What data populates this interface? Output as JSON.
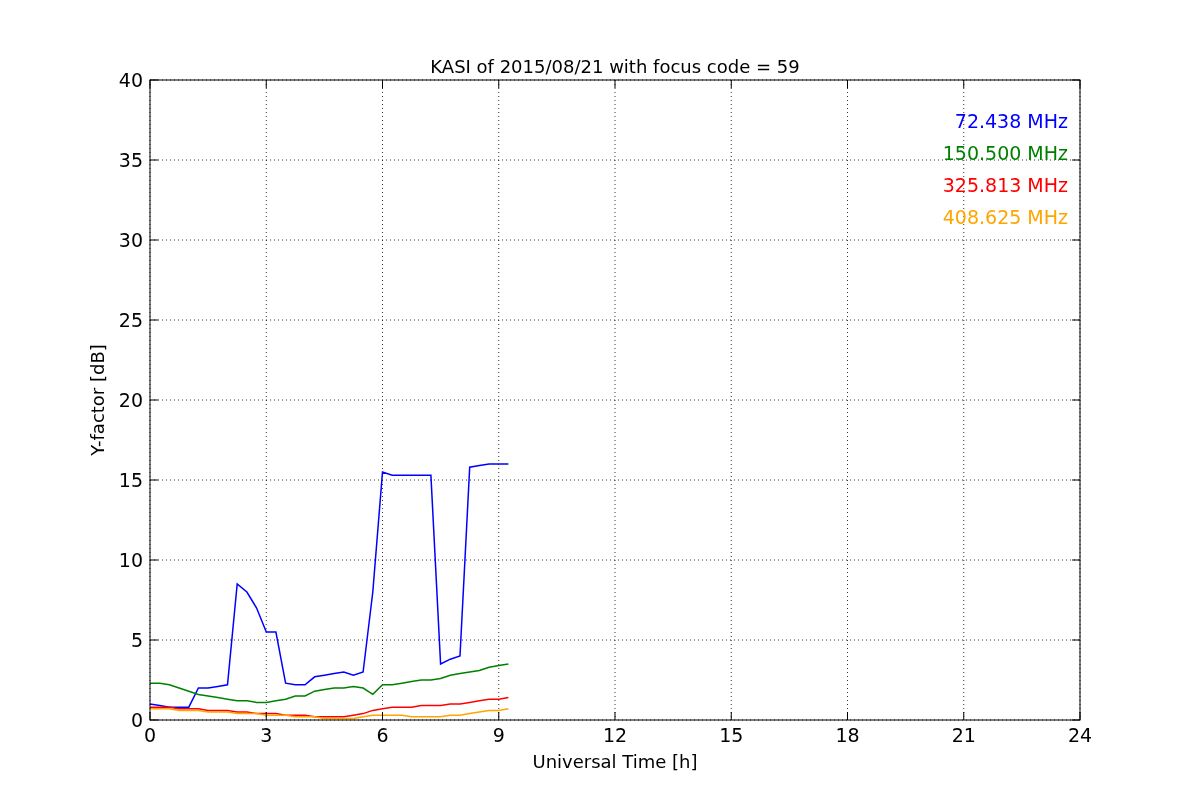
{
  "chart_data": {
    "type": "line",
    "title": "KASI of 2015/08/21 with focus code = 59",
    "xlabel": "Universal Time [h]",
    "ylabel": "Y-factor [dB]",
    "x": [
      0,
      0.25,
      0.5,
      0.75,
      1,
      1.25,
      1.5,
      1.75,
      2,
      2.25,
      2.5,
      2.75,
      3,
      3.25,
      3.5,
      3.75,
      4,
      4.25,
      4.5,
      4.75,
      5,
      5.25,
      5.5,
      5.75,
      6,
      6.25,
      6.5,
      6.75,
      7,
      7.25,
      7.5,
      7.75,
      8,
      8.25,
      8.5,
      8.75,
      9,
      9.25
    ],
    "series": [
      {
        "name": "72.438 MHz",
        "color": "#0000ff",
        "values": [
          1.0,
          0.9,
          0.8,
          0.8,
          0.8,
          2.0,
          2.0,
          2.1,
          2.2,
          8.5,
          8.0,
          7.0,
          5.5,
          5.5,
          2.3,
          2.2,
          2.2,
          2.7,
          2.8,
          2.9,
          3.0,
          2.8,
          3.0,
          8.0,
          15.5,
          15.3,
          15.3,
          15.3,
          15.3,
          15.3,
          3.5,
          3.8,
          4.0,
          15.8,
          15.9,
          16.0,
          16.0,
          16.0
        ]
      },
      {
        "name": "150.500 MHz",
        "color": "#008000",
        "values": [
          2.3,
          2.3,
          2.2,
          2.0,
          1.8,
          1.6,
          1.5,
          1.4,
          1.3,
          1.2,
          1.2,
          1.1,
          1.1,
          1.2,
          1.3,
          1.5,
          1.5,
          1.8,
          1.9,
          2.0,
          2.0,
          2.1,
          2.0,
          1.6,
          2.2,
          2.2,
          2.3,
          2.4,
          2.5,
          2.5,
          2.6,
          2.8,
          2.9,
          3.0,
          3.1,
          3.3,
          3.4,
          3.5
        ]
      },
      {
        "name": "325.813 MHz",
        "color": "#ff0000",
        "values": [
          0.8,
          0.8,
          0.8,
          0.7,
          0.7,
          0.7,
          0.6,
          0.6,
          0.6,
          0.5,
          0.5,
          0.4,
          0.4,
          0.4,
          0.3,
          0.3,
          0.3,
          0.2,
          0.2,
          0.2,
          0.2,
          0.3,
          0.4,
          0.6,
          0.7,
          0.8,
          0.8,
          0.8,
          0.9,
          0.9,
          0.9,
          1.0,
          1.0,
          1.1,
          1.2,
          1.3,
          1.3,
          1.4
        ]
      },
      {
        "name": "408.625 MHz",
        "color": "#ffa500",
        "values": [
          0.7,
          0.7,
          0.7,
          0.6,
          0.6,
          0.6,
          0.5,
          0.5,
          0.5,
          0.4,
          0.4,
          0.4,
          0.3,
          0.3,
          0.3,
          0.2,
          0.2,
          0.2,
          0.1,
          0.1,
          0.1,
          0.1,
          0.2,
          0.3,
          0.3,
          0.3,
          0.3,
          0.2,
          0.2,
          0.2,
          0.2,
          0.3,
          0.3,
          0.4,
          0.5,
          0.6,
          0.6,
          0.7
        ]
      }
    ],
    "grid": true,
    "xlim": [
      0,
      24
    ],
    "ylim": [
      0,
      40
    ],
    "xticks": [
      0,
      3,
      6,
      9,
      12,
      15,
      18,
      21,
      24
    ],
    "yticks": [
      0,
      5,
      10,
      15,
      20,
      25,
      30,
      35,
      40
    ]
  }
}
